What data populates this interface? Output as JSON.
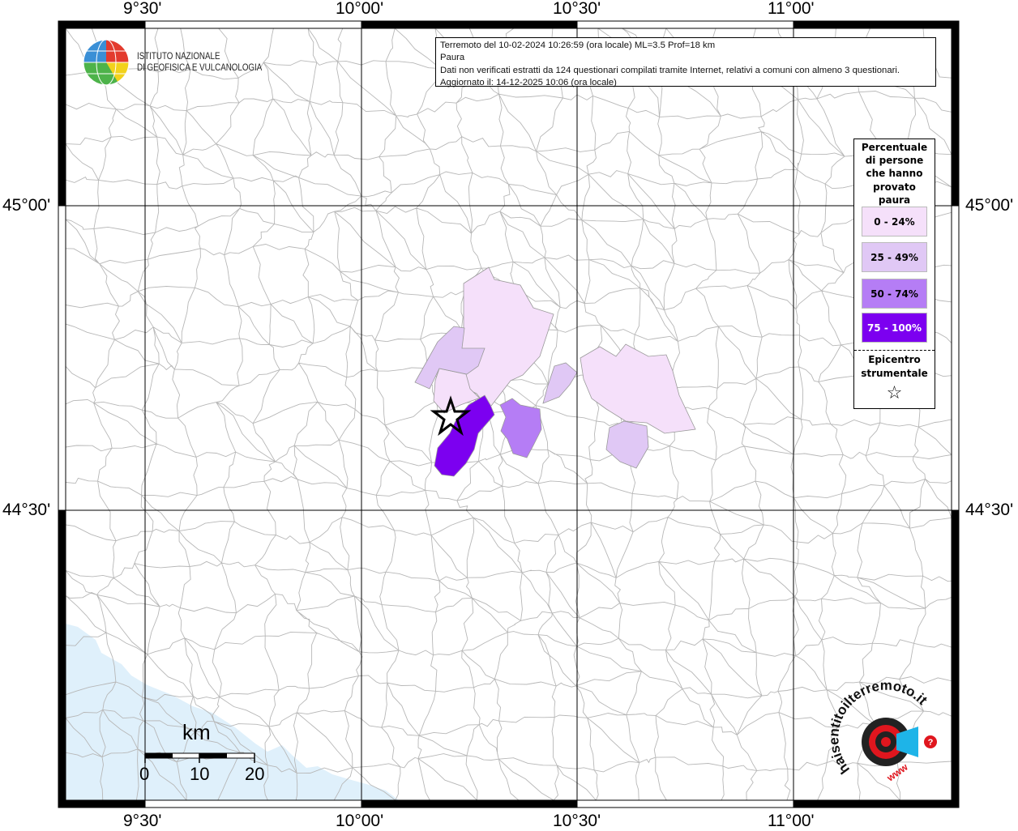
{
  "map": {
    "longitude_labels": [
      "9°30'",
      "10°00'",
      "10°30'",
      "11°00'"
    ],
    "latitude_labels": [
      "45°00'",
      "44°30'"
    ]
  },
  "info": {
    "line1": "Terremoto del 10-02-2024 10:26:59 (ora locale) ML=3.5 Prof=18 km",
    "line2": "Paura",
    "line3": "Dati non verificati estratti da 124 questionari compilati tramite Internet, relativi a comuni con almeno 3 questionari.",
    "line4": "Aggiornato il: 14-12-2025 10:06 (ora locale)"
  },
  "logo_ingv": {
    "line1": "ISTITUTO NAZIONALE",
    "line2": "DI GEOFISICA E VULCANOLOGIA"
  },
  "legend": {
    "title_lines": [
      "Percentuale",
      "di persone",
      "che hanno",
      "provato",
      "paura"
    ],
    "classes": [
      {
        "label": "0 - 24%",
        "color": "#f5e0fa"
      },
      {
        "label": "25 - 49%",
        "color": "#e0c8f5"
      },
      {
        "label": "50 - 74%",
        "color": "#b57df5"
      },
      {
        "label": "75 - 100%",
        "color": "#7c00f0"
      }
    ],
    "epicenter_lines": [
      "Epicentro",
      "strumentale"
    ],
    "epicenter_symbol": "☆"
  },
  "scale": {
    "unit": "km",
    "ticks": [
      "0",
      "10",
      "20"
    ]
  },
  "logo_hsit": {
    "text": "haisentitoilterremoto.it",
    "url": "www"
  },
  "colors": {
    "sea": "#dff0fb",
    "border_line": "#b7b7b7",
    "grid": "#000000"
  }
}
